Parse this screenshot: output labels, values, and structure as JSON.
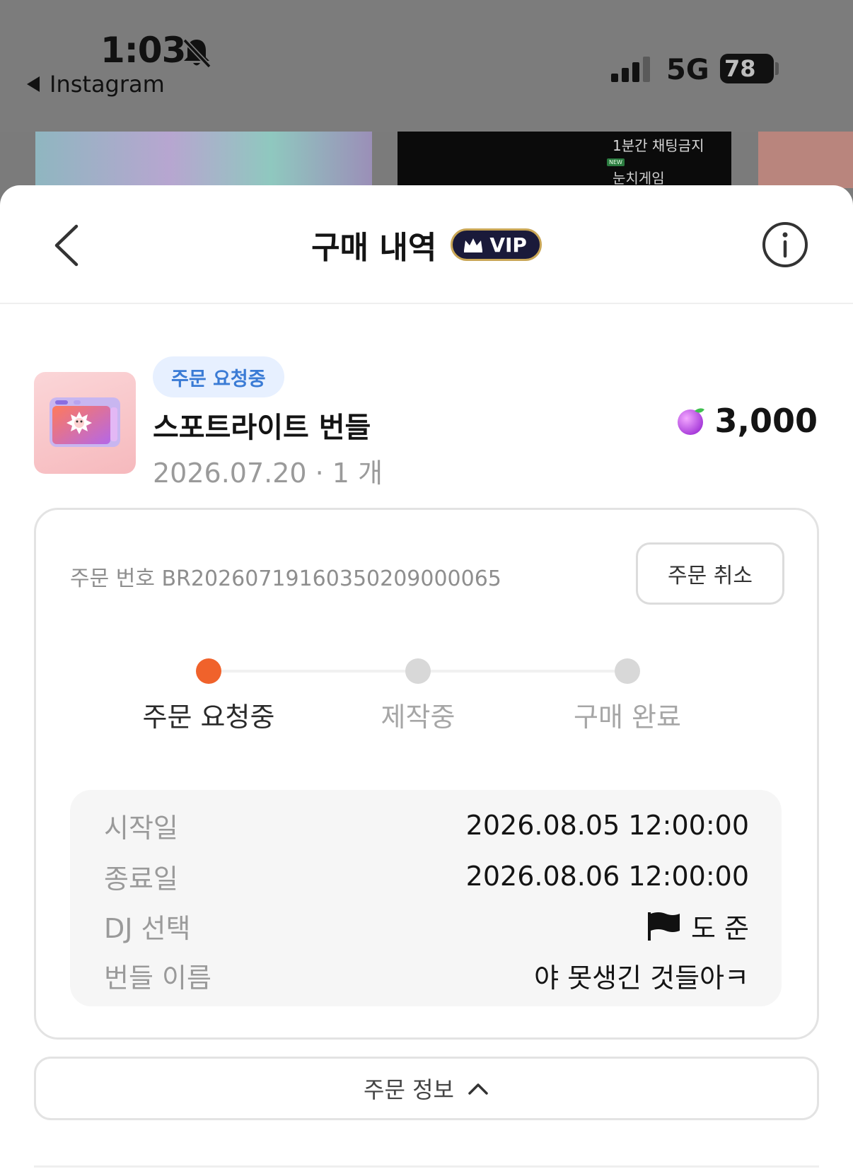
{
  "status_bar": {
    "time": "1:03",
    "back_app": "Instagram",
    "network": "5G",
    "battery": "78"
  },
  "background": {
    "thumb_text_1": "1분간 채팅금지",
    "thumb_badge": "NEW",
    "thumb_text_2": "눈치게임"
  },
  "header": {
    "title": "구매 내역",
    "vip_label": "VIP"
  },
  "product": {
    "status_pill": "주문 요청중",
    "name": "스포트라이트 번들",
    "meta": "2026.07.20 · 1 개",
    "price": "3,000"
  },
  "order": {
    "order_number": "주문 번호 BR20260719160350209000065",
    "cancel_label": "주문 취소",
    "steps": [
      {
        "label": "주문 요청중",
        "active": true
      },
      {
        "label": "제작중",
        "active": false
      },
      {
        "label": "구매 완료",
        "active": false
      }
    ],
    "details": [
      {
        "label": "시작일",
        "value": "2026.08.05 12:00:00"
      },
      {
        "label": "종료일",
        "value": "2026.08.06 12:00:00"
      },
      {
        "label": "DJ 선택",
        "value": "도 준"
      },
      {
        "label": "번들 이름",
        "value": "야 못생긴 것들아ㅋ"
      }
    ]
  },
  "order_info_button": "주문 정보",
  "colors": {
    "accent_active": "#f0622b",
    "pill_bg": "#e7f0ff",
    "pill_text": "#3a7bd5",
    "vip_bg": "#1a1a3a",
    "vip_border": "#c9a656"
  },
  "icons": {
    "back": "chevron-left-icon",
    "info": "info-circle-icon",
    "gem": "purple-gem-icon",
    "flag": "black-flag-icon",
    "bell": "bell-slash-icon",
    "expand": "chevron-up-icon"
  }
}
